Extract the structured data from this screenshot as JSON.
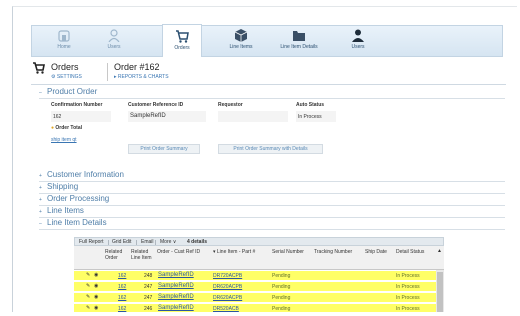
{
  "nav": {
    "items": [
      {
        "label": "Home"
      },
      {
        "label": "Users"
      },
      {
        "label": "Orders"
      },
      {
        "label": "Line Items"
      },
      {
        "label": "Line Item Details"
      },
      {
        "label": "Users"
      }
    ]
  },
  "header": {
    "title": "Orders",
    "order": "Order #162",
    "settings": "SETTINGS",
    "reports": "REPORTS & CHARTS"
  },
  "sections": {
    "product_order": "Product Order",
    "customer_information": "Customer Information",
    "shipping": "Shipping",
    "order_processing": "Order Processing",
    "line_items": "Line Items",
    "line_item_details": "Line Item Details"
  },
  "product_order": {
    "confirmation_label": "Confirmation Number",
    "confirmation_value": "162",
    "customer_ref_label": "Customer Reference ID",
    "customer_ref_value": "SampleRefID",
    "requestor_label": "Requestor",
    "requestor_value": "",
    "auto_status_label": "Auto Status",
    "auto_status_value": "In Process",
    "order_total_label": "Order Total",
    "link": "ship item qt",
    "print_summary": "Print Order Summary",
    "print_summary_details": "Print Order Summary with Details"
  },
  "grid": {
    "toolbar": {
      "full_report": "Full Report",
      "grid_edit": "Grid Edit",
      "email": "Email",
      "more": "More ∨",
      "count": "4 details"
    },
    "headers": {
      "related_order": "Related Order",
      "related_line_item": "Related Line Item",
      "order_cust_ref": "Order - Cust Ref ID",
      "line_item_part": "Line Item - Part #",
      "serial_number": "Serial Number",
      "tracking_number": "Tracking Number",
      "ship_date": "Ship Date",
      "detail_status": "Detail Status"
    },
    "rows": [
      {
        "order": "162",
        "line_item": "248",
        "cust_ref": "SampleRefID",
        "part": "DR720ACPB",
        "serial": "Pending",
        "status": "In Process"
      },
      {
        "order": "162",
        "line_item": "247",
        "cust_ref": "SampleRefID",
        "part": "DR620ACPB",
        "serial": "Pending",
        "status": "In Process"
      },
      {
        "order": "162",
        "line_item": "247",
        "cust_ref": "SampleRefID",
        "part": "DR620ACPB",
        "serial": "Pending",
        "status": "In Process"
      },
      {
        "order": "162",
        "line_item": "246",
        "cust_ref": "SampleRefID",
        "part": "DR520ACB",
        "serial": "Pending",
        "status": "In Process"
      }
    ]
  },
  "colors": {
    "accent": "#4f7ea8",
    "row_highlight": "#ffff66",
    "link": "#3a76b3"
  }
}
